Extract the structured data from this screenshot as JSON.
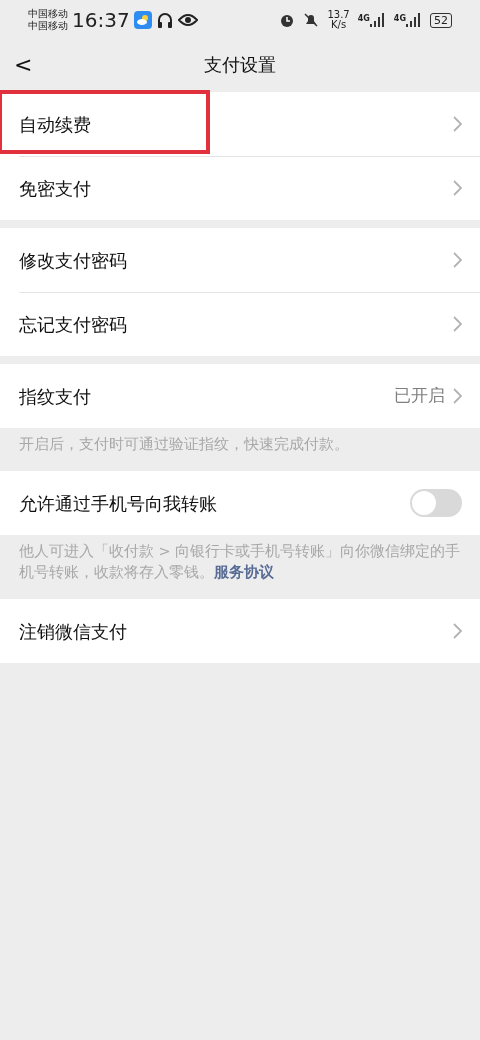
{
  "status_bar": {
    "carriers": [
      "中国移动",
      "中国移动"
    ],
    "time": "16:37",
    "speed_value": "13.7",
    "speed_unit": "K/s",
    "networks": [
      "4G",
      "4G"
    ],
    "battery": "52"
  },
  "header": {
    "back": "<",
    "title": "支付设置"
  },
  "sections": [
    {
      "rows": [
        {
          "kind": "link",
          "label": "自动续费",
          "highlighted": true
        },
        {
          "kind": "link",
          "label": "免密支付",
          "highlighted": false
        }
      ]
    },
    {
      "rows": [
        {
          "kind": "link",
          "label": "修改支付密码",
          "highlighted": false
        },
        {
          "kind": "link",
          "label": "忘记支付密码",
          "highlighted": false
        }
      ]
    },
    {
      "rows": [
        {
          "kind": "link",
          "label": "指纹支付",
          "value": "已开启",
          "highlighted": false
        }
      ],
      "note": {
        "text": "开启后，支付时可通过验证指纹，快速完成付款。"
      }
    },
    {
      "rows": [
        {
          "kind": "toggle",
          "label": "允许通过手机号向我转账",
          "on": false,
          "highlighted": false
        }
      ],
      "note": {
        "text": "他人可进入「收付款 > 向银行卡或手机号转账」向你微信绑定的手机号转账，收款将存入零钱。",
        "link": "服务协议"
      }
    },
    {
      "rows": [
        {
          "kind": "link",
          "label": "注销微信支付",
          "highlighted": false
        }
      ]
    }
  ]
}
